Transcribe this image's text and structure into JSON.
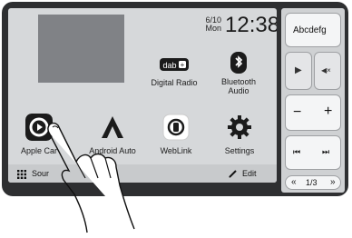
{
  "status": {
    "date_line1": "6/10",
    "date_line2": "Mon",
    "time": "12:38"
  },
  "tiles": [
    {
      "label": "Digital Radio",
      "icon": "dab-radio-icon",
      "badge": "dab"
    },
    {
      "label_line1": "Bluetooth",
      "label_line2": "Audio",
      "icon": "bluetooth-icon"
    },
    {
      "label": "Apple Car",
      "icon": "carplay-icon"
    },
    {
      "label": "Android Auto",
      "icon": "android-auto-icon"
    },
    {
      "label": "WebLink",
      "icon": "weblink-icon"
    },
    {
      "label": "Settings",
      "icon": "gear-icon"
    }
  ],
  "bottombar": {
    "sources_label": "Sour",
    "edit_label": "Edit"
  },
  "side": {
    "top_label": "Abcdefg",
    "play_symbol": "▶",
    "mute_symbol": "◀×",
    "minus_symbol": "−",
    "plus_symbol": "+",
    "prev_symbol": "⏮",
    "next_symbol": "⏭",
    "page_prev": "«",
    "page_indicator": "1/3",
    "page_next": "»"
  }
}
